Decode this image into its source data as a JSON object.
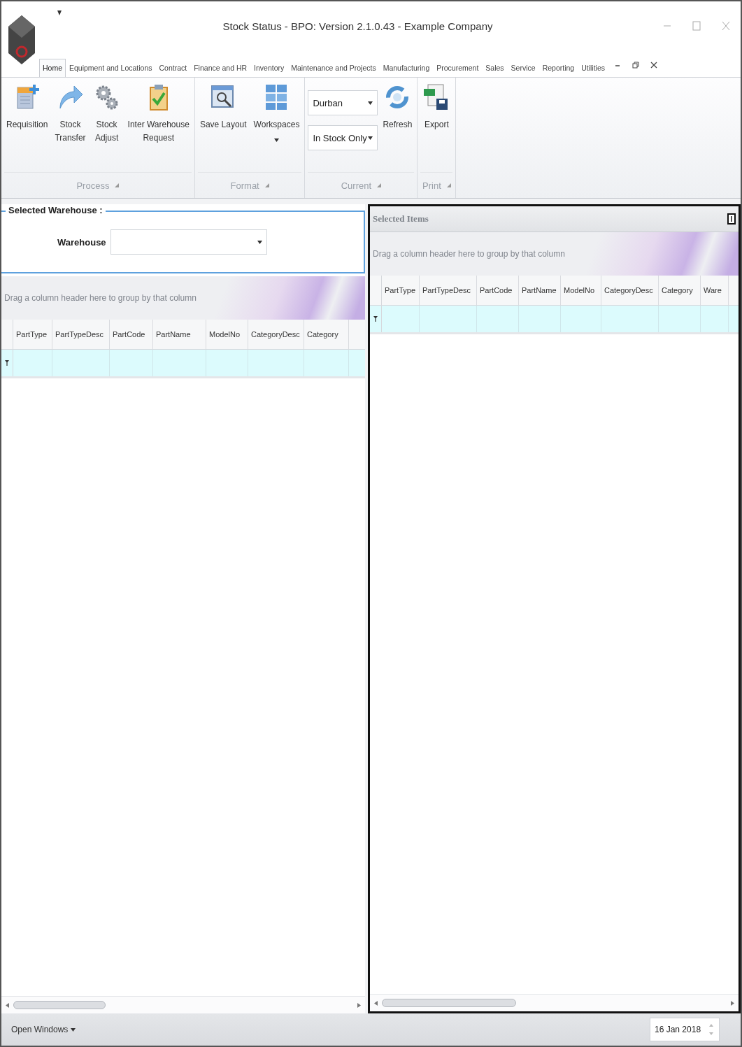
{
  "window": {
    "title": "Stock Status - BPO: Version 2.1.0.43 - Example Company"
  },
  "tabs": [
    {
      "label": "Home",
      "selected": true
    },
    {
      "label": "Equipment and Locations",
      "selected": false
    },
    {
      "label": "Contract",
      "selected": false
    },
    {
      "label": "Finance and HR",
      "selected": false
    },
    {
      "label": "Inventory",
      "selected": false
    },
    {
      "label": "Maintenance and Projects",
      "selected": false
    },
    {
      "label": "Manufacturing",
      "selected": false
    },
    {
      "label": "Procurement",
      "selected": false
    },
    {
      "label": "Sales",
      "selected": false
    },
    {
      "label": "Service",
      "selected": false
    },
    {
      "label": "Reporting",
      "selected": false
    },
    {
      "label": "Utilities",
      "selected": false
    }
  ],
  "ribbon": {
    "groups": [
      {
        "label": "Process",
        "items": [
          {
            "kind": "button",
            "lines": [
              "Requisition"
            ]
          },
          {
            "kind": "button",
            "lines": [
              "Stock",
              "Transfer"
            ]
          },
          {
            "kind": "button",
            "lines": [
              "Stock",
              "Adjust"
            ]
          },
          {
            "kind": "button",
            "lines": [
              "Inter Warehouse",
              "Request"
            ]
          }
        ]
      },
      {
        "label": "Format",
        "items": [
          {
            "kind": "button",
            "lines": [
              "Save Layout"
            ]
          },
          {
            "kind": "split",
            "lines": [
              "Workspaces"
            ]
          }
        ]
      },
      {
        "label": "Current",
        "items": [
          {
            "kind": "combos",
            "values": [
              "Durban",
              "In Stock Only"
            ]
          },
          {
            "kind": "button",
            "lines": [
              "Refresh"
            ]
          }
        ]
      },
      {
        "label": "Print",
        "items": [
          {
            "kind": "button",
            "lines": [
              "Export"
            ]
          }
        ]
      }
    ]
  },
  "left_panel": {
    "group_title": "Selected Warehouse :",
    "field": {
      "label": "Warehouse"
    },
    "grid": {
      "group_hint": "Drag a column header here to group by that column",
      "columns": [
        "PartType",
        "PartTypeDesc",
        "PartCode",
        "PartName",
        "ModelNo",
        "CategoryDesc",
        "Category"
      ]
    }
  },
  "right_panel": {
    "title": "Selected Items",
    "grid": {
      "group_hint": "Drag a column header here to group by that column",
      "columns": [
        "PartType",
        "PartTypeDesc",
        "PartCode",
        "PartName",
        "ModelNo",
        "CategoryDesc",
        "Category",
        "Ware"
      ]
    }
  },
  "status_bar": {
    "menu": "Open Windows",
    "date": "16 Jan 2018"
  }
}
